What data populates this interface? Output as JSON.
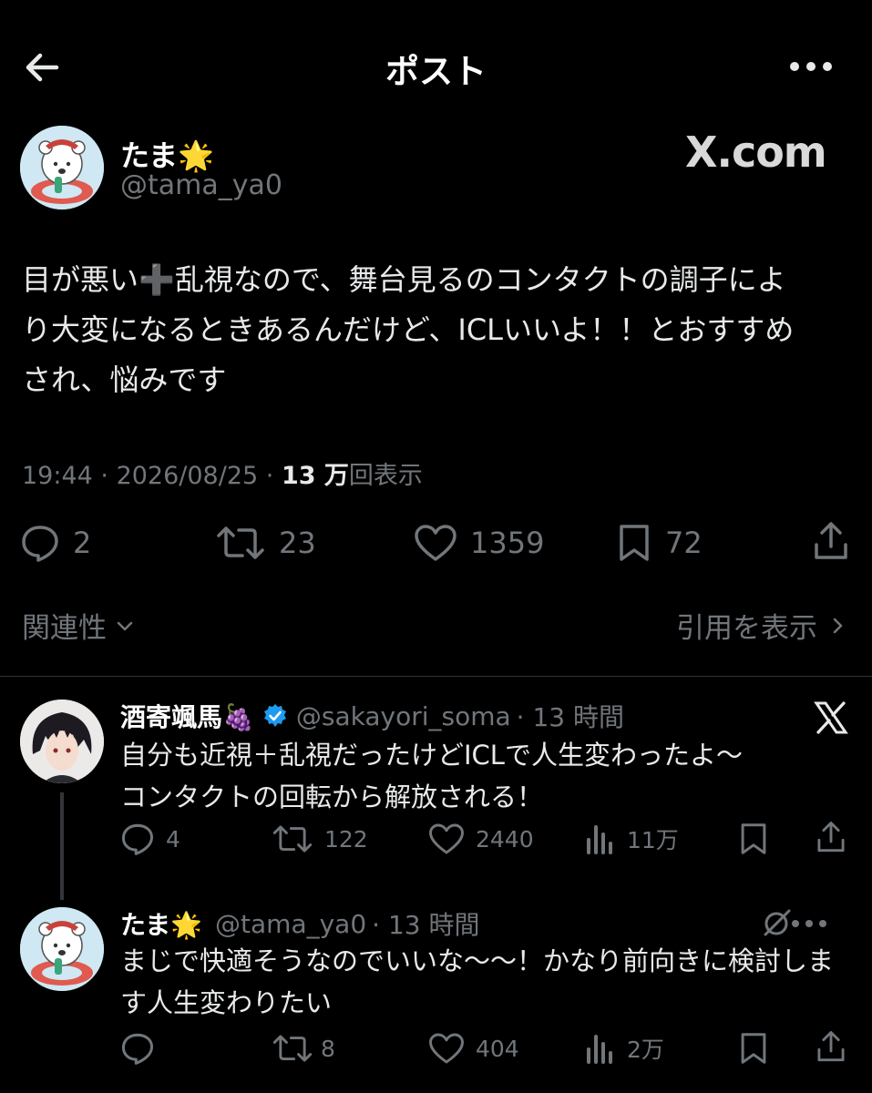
{
  "header": {
    "title": "ポスト",
    "back_icon": "arrow-left-icon",
    "more_icon": "more-horizontal-icon"
  },
  "post": {
    "author_name": "たま🌟",
    "author_handle": "@tama_ya0",
    "watermark": "X.com",
    "text_lines": [
      "目が悪い➕乱視なので、舞台見るのコンタクトの調子によ",
      "り大変になるときあるんだけど、ICLいいよ！！とおすすめ",
      "され、悩みです"
    ],
    "time": "19:44",
    "date": "2026/08/25",
    "views_count": "13 万",
    "views_label": "回表示",
    "stats": {
      "replies": "2",
      "reposts": "23",
      "likes": "1359",
      "bookmarks": "72"
    }
  },
  "filters": {
    "sort_label": "関連性",
    "quotes_label": "引用を表示"
  },
  "replies": [
    {
      "name": "酒寄颯馬🍇",
      "verified": true,
      "handle": "@sakayori_soma",
      "time": "· 13 時間",
      "text_lines": [
        "自分も近視＋乱視だったけどICLで人生変わったよ〜",
        "コンタクトの回転から解放される！"
      ],
      "stats": {
        "replies": "4",
        "reposts": "122",
        "likes": "2440",
        "views": "11万"
      }
    },
    {
      "name": "たま🌟",
      "handle": "@tama_ya0",
      "time": "· 13 時間",
      "text_lines": [
        "まじで快適そうなのでいいな〜〜！かなり前向きに検討しま",
        "す人生変わりたい"
      ],
      "stats": {
        "replies": "",
        "reposts": "8",
        "likes": "404",
        "views": "2万"
      }
    }
  ],
  "colors": {
    "background": "#000000",
    "text": "#e7e9ea",
    "secondary": "#71767b",
    "verified": "#1d9bf0",
    "divider": "#2f3336"
  }
}
